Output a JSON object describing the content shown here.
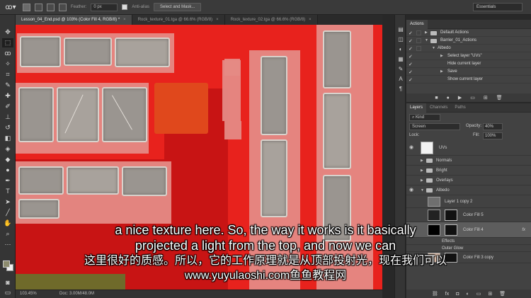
{
  "options_bar": {
    "feather_label": "Feather:",
    "feather_value": "0 px",
    "anti_alias_label": "Anti-alias",
    "select_mask_button": "Select and Mask...",
    "workspace": "Essentials"
  },
  "tabs": [
    {
      "label": "Lesson_04_End.psd @ 103% (Color Fill 4, RGB/8) *"
    },
    {
      "label": "Rock_texture_01.tga @ 66.6% (RGB/8)"
    },
    {
      "label": "Rock_texture_02.tga @ 66.6% (RGB/8)"
    }
  ],
  "status": {
    "zoom": "103.45%",
    "doc": "Doc: 3.00M/48.0M"
  },
  "actions_panel": {
    "tab": "Actions",
    "items": [
      {
        "label": "Default Actions"
      },
      {
        "label": "Barrier_01_Actions"
      },
      {
        "label": "Albedo"
      },
      {
        "label": "Select layer \"UVs\""
      },
      {
        "label": "Hide current layer"
      },
      {
        "label": "Save"
      },
      {
        "label": "Show current layer"
      }
    ]
  },
  "layers_panel": {
    "tabs": [
      "Layers",
      "Channels",
      "Paths"
    ],
    "kind": "Kind",
    "blend_mode": "Screen",
    "opacity_label": "Opacity:",
    "opacity_value": "40%",
    "lock_label": "Lock:",
    "fill_label": "Fill:",
    "fill_value": "100%",
    "layers": [
      {
        "name": "UVs"
      },
      {
        "name": "Normals"
      },
      {
        "name": "Bright"
      },
      {
        "name": "Overlays"
      },
      {
        "name": "Albedo"
      },
      {
        "name": "Layer 1 copy 2"
      },
      {
        "name": "Color Fill 5"
      },
      {
        "name": "Color Fill 4"
      },
      {
        "name": "Effects"
      },
      {
        "name": "Outer Glow"
      },
      {
        "name": "Color Fill 3 copy"
      }
    ]
  },
  "subtitles": {
    "en_line1": "a nice texture here. So, the way it works is it basically",
    "en_line2": "projected a light from the top, and now we can",
    "zh_line": "这里很好的质感。所以，它的工作原理就是从顶部投射光，现在我们可以",
    "url_line": "www.yuyulaoshi.com鱼鱼教程网"
  }
}
